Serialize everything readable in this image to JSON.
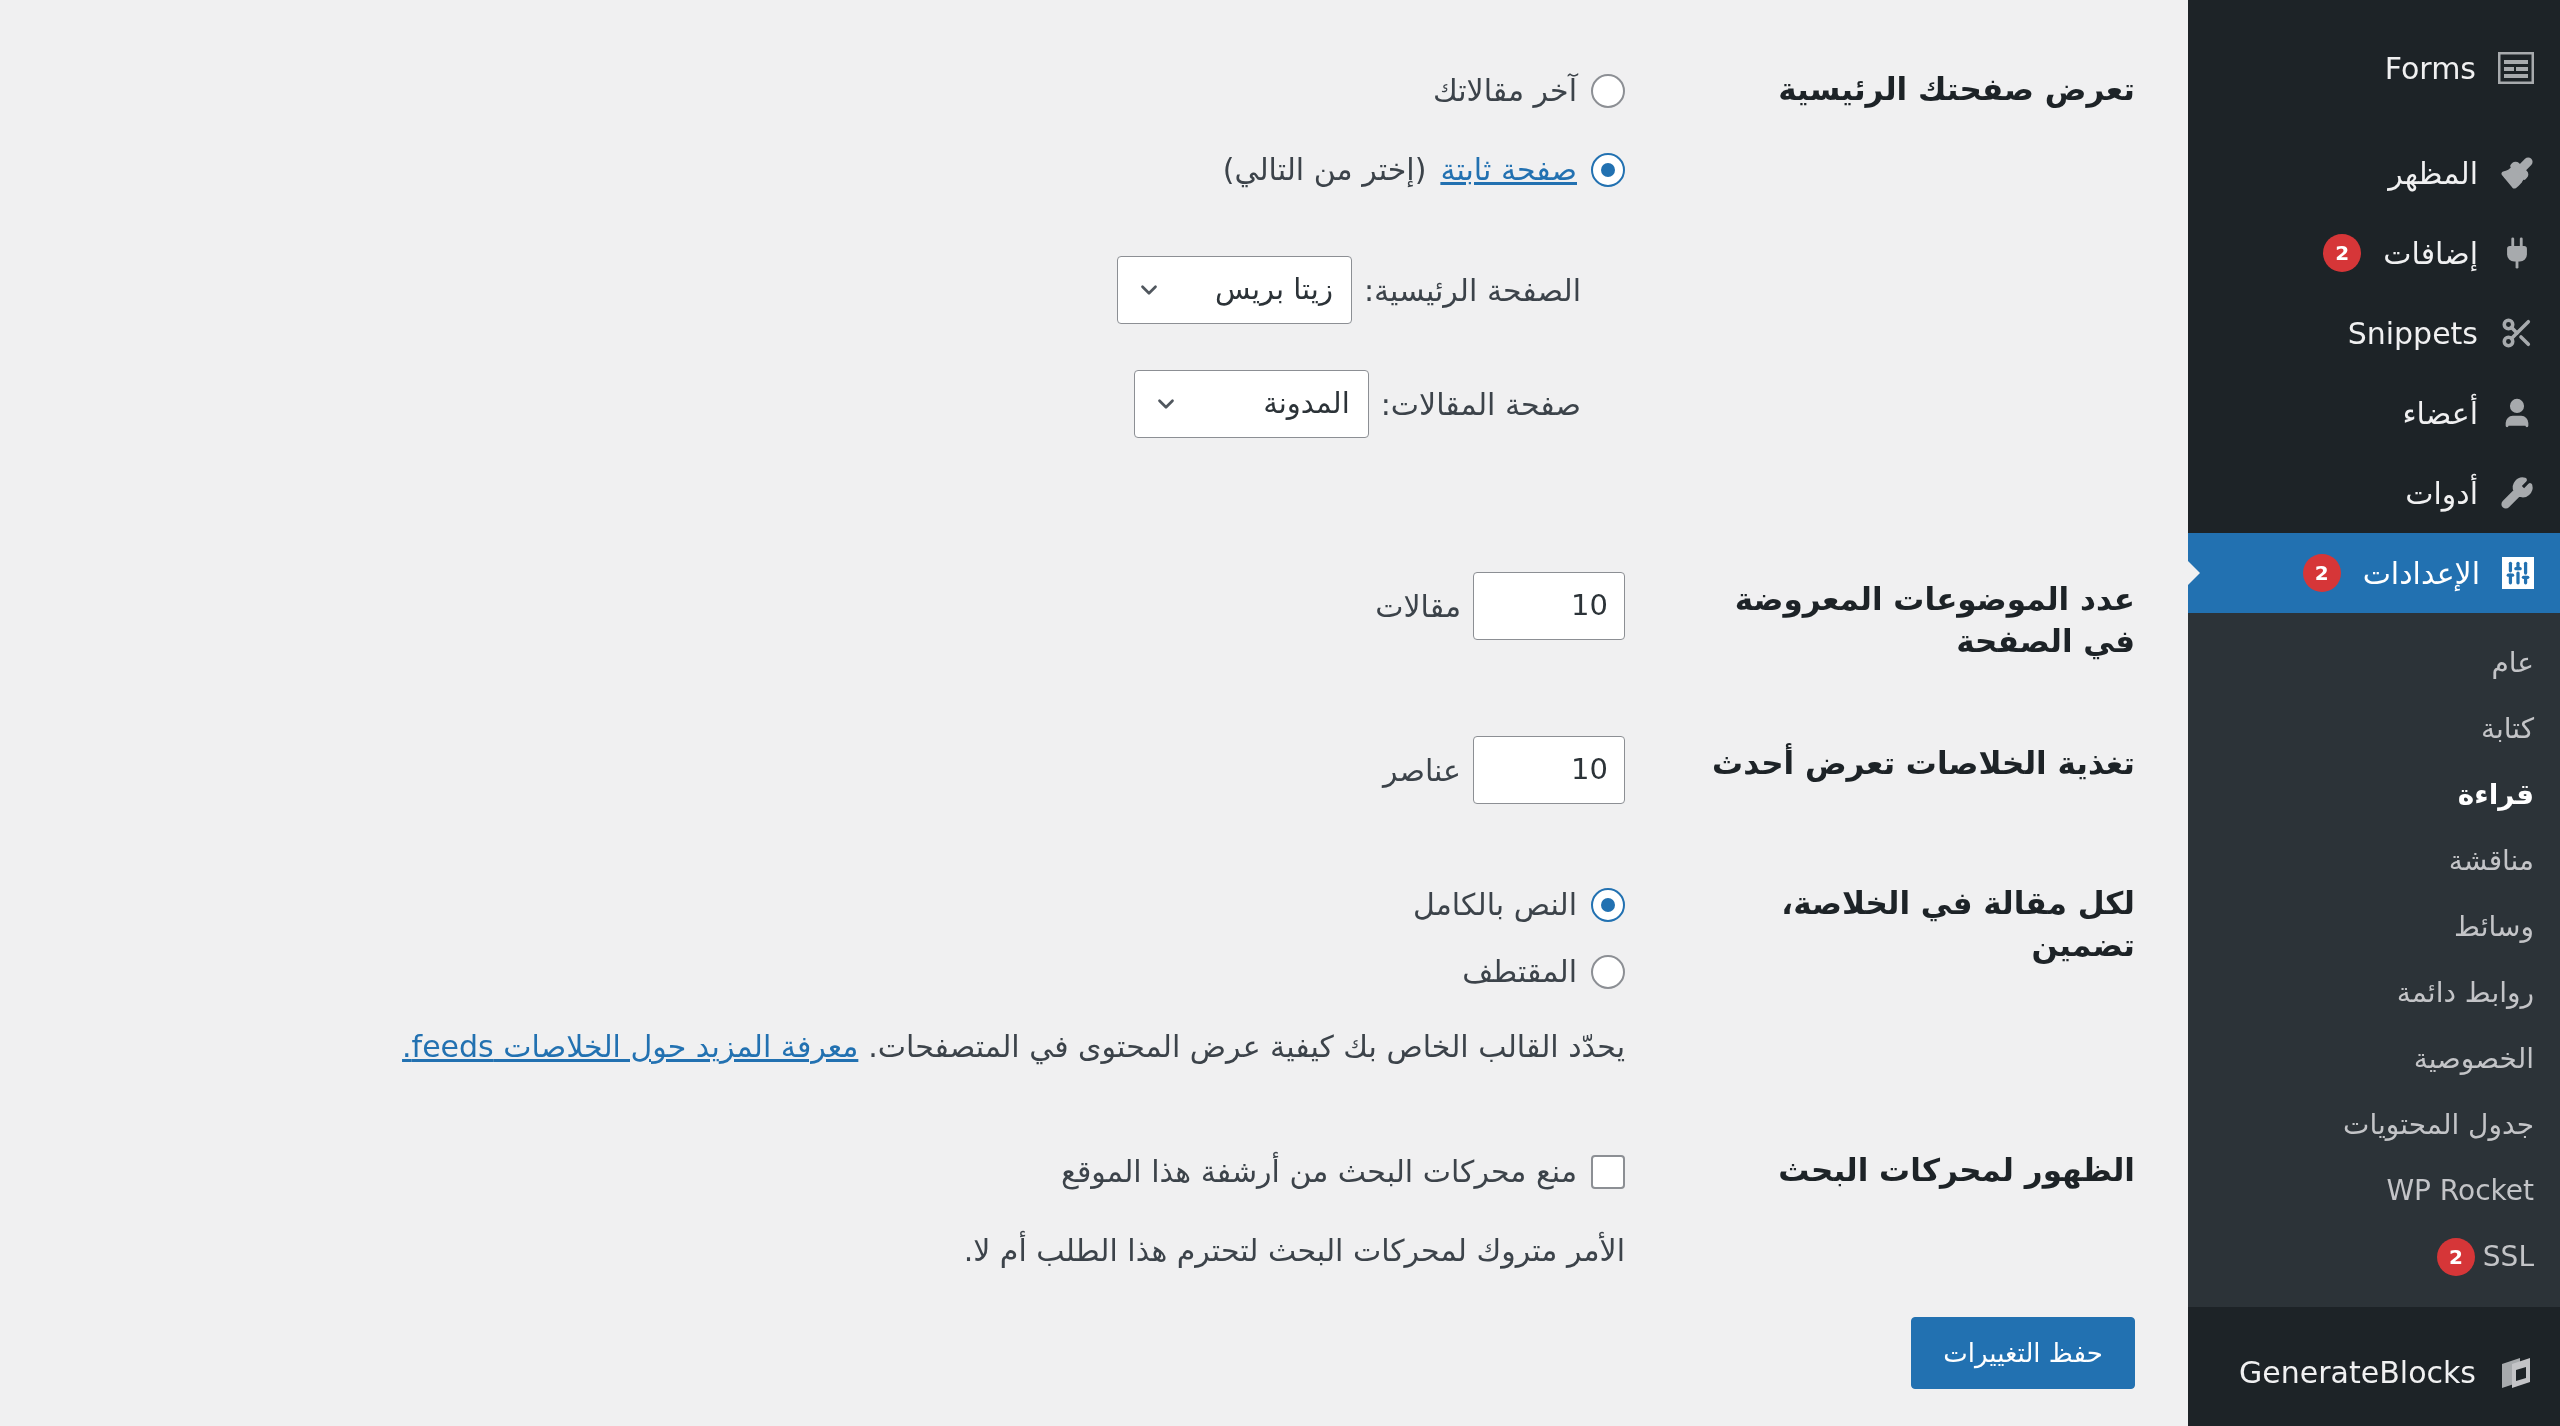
{
  "sidebar": {
    "menu": [
      {
        "label": "Forms",
        "selected": false
      },
      {
        "label": "المظهر",
        "selected": false
      },
      {
        "label": "إضافات",
        "badge": "2",
        "selected": false
      },
      {
        "label": "Snippets",
        "selected": false
      },
      {
        "label": "أعضاء",
        "selected": false
      },
      {
        "label": "أدوات",
        "selected": false
      },
      {
        "label": "الإعدادات",
        "badge": "2",
        "selected": true,
        "submenu": [
          {
            "label": "عام",
            "selected": false
          },
          {
            "label": "كتابة",
            "selected": false
          },
          {
            "label": "قراءة",
            "selected": true
          },
          {
            "label": "مناقشة",
            "selected": false
          },
          {
            "label": "وسائط",
            "selected": false
          },
          {
            "label": "روابط دائمة",
            "selected": false
          },
          {
            "label": "الخصوصية",
            "selected": false
          },
          {
            "label": "جدول المحتويات",
            "selected": false
          },
          {
            "label": "WP Rocket",
            "selected": false
          },
          {
            "label": "SSL",
            "badge": "2",
            "selected": false
          }
        ]
      },
      {
        "label": "GenerateBlocks",
        "selected": false
      }
    ]
  },
  "settings": {
    "front_page": {
      "label": "تعرض صفحتك الرئيسية",
      "options": [
        {
          "label": "آخر مقالاتك",
          "selected": false
        },
        {
          "link": "صفحة ثابتة",
          "label": "(إختر من التالي)",
          "selected": true
        }
      ],
      "selects": [
        {
          "label": "الصفحة الرئيسية:",
          "value": "زيتا بريس"
        },
        {
          "label": "صفحة المقالات:",
          "value": "المدونة"
        }
      ]
    },
    "posts_per_page": {
      "label": "عدد الموضوعات المعروضة في الصفحة",
      "value": "10",
      "unit": "مقالات"
    },
    "feed_items": {
      "label": "تغذية الخلاصات تعرض أحدث",
      "value": "10",
      "unit": "عناصر"
    },
    "feed_content": {
      "label": "لكل مقالة في الخلاصة، تضمين",
      "options": [
        {
          "label": "النص بالكامل",
          "selected": true
        },
        {
          "label": "المقتطف",
          "selected": false
        }
      ],
      "note": "يحدّد القالب الخاص بك كيفية عرض المحتوى في المتصفحات.",
      "note_link": "معرفة المزيد حول الخلاصات feeds."
    },
    "search_visibility": {
      "label": "الظهور لمحركات البحث",
      "checkbox": {
        "label": "منع محركات البحث من أرشفة هذا الموقع",
        "checked": false
      },
      "note": "الأمر متروك لمحركات البحث لتحترم هذا الطلب أم لا."
    }
  },
  "save_button": "حفظ التغييرات"
}
